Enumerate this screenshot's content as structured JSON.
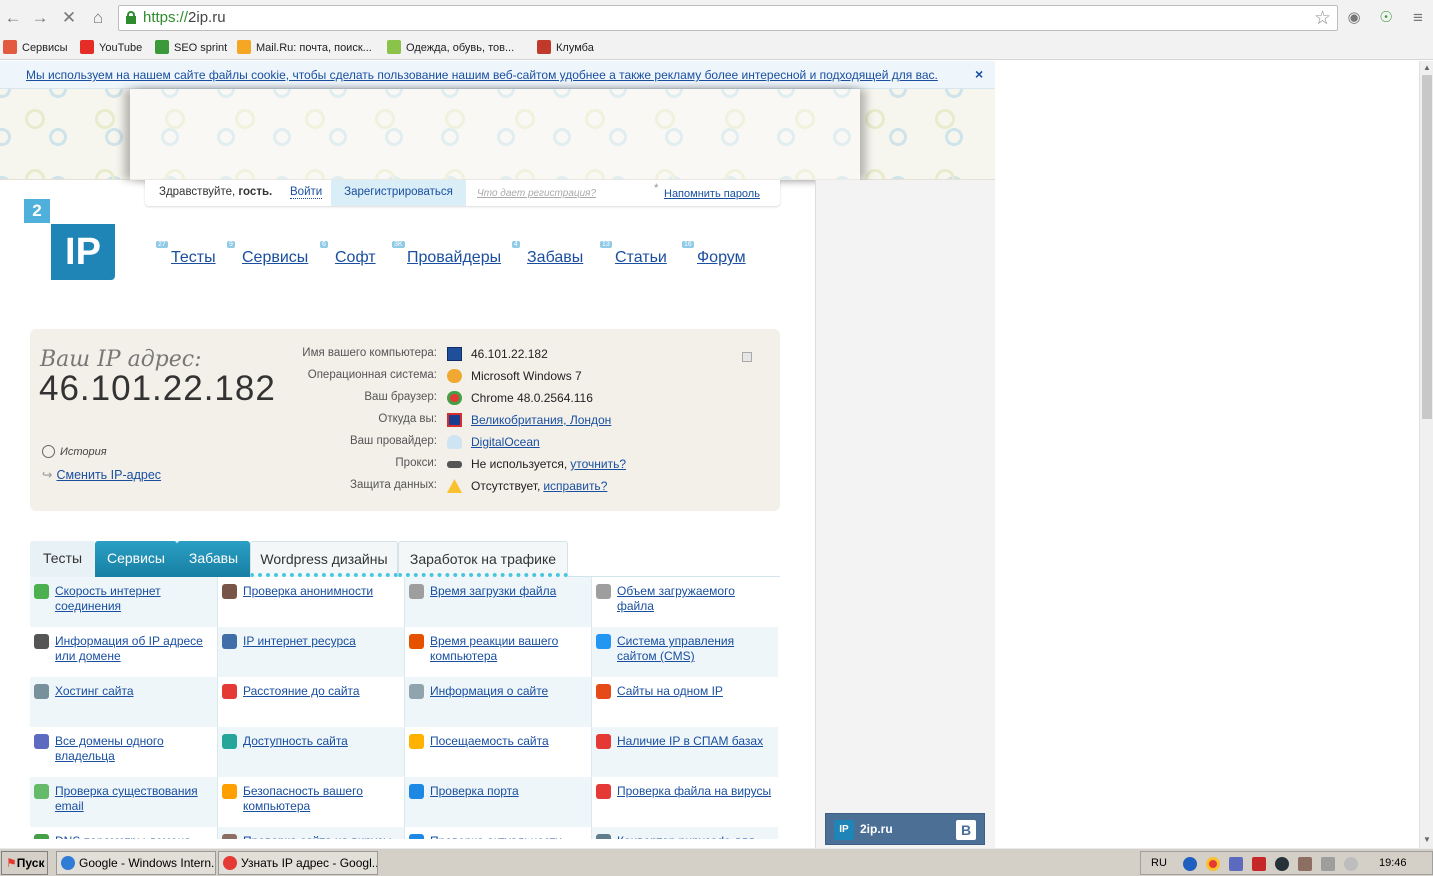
{
  "browser": {
    "url_scheme": "https://",
    "url_host": "2ip.ru",
    "bookmarks": [
      {
        "label": "Сервисы",
        "icon": "apps-grid-icon",
        "color": "#e25b3f"
      },
      {
        "label": "YouTube",
        "icon": "youtube-icon",
        "color": "#e52d27"
      },
      {
        "label": "SEO sprint",
        "icon": "seosprint-icon",
        "color": "#3a9a3a"
      },
      {
        "label": "Mail.Ru: почта, поиск...",
        "icon": "mailru-icon",
        "color": "#f5a623"
      },
      {
        "label": "Одежда, обувь, тов...",
        "icon": "shop-icon",
        "color": "#8bc34a"
      },
      {
        "label": "Клумба",
        "icon": "klumba-icon",
        "color": "#c0392b"
      }
    ]
  },
  "cookie": {
    "text": "Мы используем на нашем сайте файлы cookie, чтобы сделать пользование нашим веб-сайтом удобнее а также рекламу более интересной и подходящей для вас.",
    "close": "×"
  },
  "login": {
    "greeting": "Здравствуйте,",
    "guest": "гость.",
    "login": "Войти",
    "register": "Зарегистрироваться",
    "why": "Что дает регистрация?",
    "asterisk": "*",
    "remind": "Напомнить пароль"
  },
  "logo": {
    "two": "2",
    "ip": "IP"
  },
  "nav": [
    {
      "label": "Тесты",
      "count": "27"
    },
    {
      "label": "Сервисы",
      "count": "9"
    },
    {
      "label": "Софт",
      "count": "6"
    },
    {
      "label": "Провайдеры",
      "count": "3K"
    },
    {
      "label": "Забавы",
      "count": "4"
    },
    {
      "label": "Статьи",
      "count": "13"
    },
    {
      "label": "Форум",
      "count": "16"
    }
  ],
  "ipinfo": {
    "label": "Ваш IP адрес:",
    "value": "46.101.22.182",
    "history": "История",
    "change": "Сменить IP-адрес",
    "rows": [
      {
        "label": "Имя вашего компьютера:",
        "value": "46.101.22.182",
        "link": "",
        "icon": "computer-icon"
      },
      {
        "label": "Операционная система:",
        "value": "Microsoft Windows 7",
        "link": "",
        "icon": "windows-icon"
      },
      {
        "label": "Ваш браузер:",
        "value": "Chrome 48.0.2564.116",
        "link": "",
        "icon": "chrome-icon"
      },
      {
        "label": "Откуда вы:",
        "value": "",
        "link": "Великобритания, Лондон",
        "icon": "uk-flag-icon"
      },
      {
        "label": "Ваш провайдер:",
        "value": "",
        "link": "DigitalOcean",
        "icon": "cloud-icon"
      },
      {
        "label": "Прокси:",
        "value": "Не используется,",
        "link": "уточнить?",
        "icon": "glasses-icon"
      },
      {
        "label": "Защита данных:",
        "value": "Отсутствует,",
        "link": "исправить?",
        "icon": "warning-icon"
      }
    ]
  },
  "tabs": [
    {
      "label": "Тесты",
      "style": "light"
    },
    {
      "label": "Сервисы",
      "style": "active"
    },
    {
      "label": "Забавы",
      "style": "active"
    },
    {
      "label": "Wordpress дизайны",
      "style": "plain"
    },
    {
      "label": "Заработок на трафике",
      "style": "plain"
    }
  ],
  "tools": [
    {
      "label": "Скорость интернет соединения",
      "icon": "speed-icon",
      "color": "#4caf50"
    },
    {
      "label": "Проверка анонимности",
      "icon": "anonymity-icon",
      "color": "#795548"
    },
    {
      "label": "Время загрузки файла",
      "icon": "clock-icon",
      "color": "#9e9e9e"
    },
    {
      "label": "Объем загружаемого файла",
      "icon": "file-size-icon",
      "color": "#9e9e9e"
    },
    {
      "label": "Информация об IP адресе или домене",
      "icon": "ip-info-icon",
      "color": "#555555"
    },
    {
      "label": "IP интернет ресурса",
      "icon": "ip-resource-icon",
      "color": "#3f6ea8"
    },
    {
      "label": "Время реакции вашего компьютера",
      "icon": "reaction-icon",
      "color": "#e65100"
    },
    {
      "label": "Система управления сайтом (CMS)",
      "icon": "cms-icon",
      "color": "#2196f3"
    },
    {
      "label": "Хостинг сайта",
      "icon": "hosting-icon",
      "color": "#78909c"
    },
    {
      "label": "Расстояние до сайта",
      "icon": "pin-icon",
      "color": "#e53935"
    },
    {
      "label": "Информация о сайте",
      "icon": "document-icon",
      "color": "#90a4ae"
    },
    {
      "label": "Сайты на одном IP",
      "icon": "network-icon",
      "color": "#e64a19"
    },
    {
      "label": "Все домены одного владельца",
      "icon": "owner-icon",
      "color": "#5c6bc0"
    },
    {
      "label": "Доступность сайта",
      "icon": "availability-icon",
      "color": "#26a69a"
    },
    {
      "label": "Посещаемость сайта",
      "icon": "star-icon",
      "color": "#ffb300"
    },
    {
      "label": "Наличие IP в СПАМ базах",
      "icon": "spam-icon",
      "color": "#e53935"
    },
    {
      "label": "Проверка существования email",
      "icon": "email-icon",
      "color": "#66bb6a"
    },
    {
      "label": "Безопасность вашего компьютера",
      "icon": "lock-icon",
      "color": "#ffa000"
    },
    {
      "label": "Проверка порта",
      "icon": "port-icon",
      "color": "#1e88e5"
    },
    {
      "label": "Проверка файла на вирусы",
      "icon": "virus-file-icon",
      "color": "#e53935"
    },
    {
      "label": "DNS параметры домена",
      "icon": "dns-icon",
      "color": "#43a047"
    },
    {
      "label": "Проверка сайта на вирусы",
      "icon": "virus-site-icon",
      "color": "#8d6e63"
    },
    {
      "label": "Проверка актуальности",
      "icon": "globe-icon",
      "color": "#1e88e5"
    },
    {
      "label": "Конвертер punycode для",
      "icon": "converter-icon",
      "color": "#607d8b"
    }
  ],
  "vk_widget": {
    "ip": "IP",
    "name": "2ip.ru",
    "b": "B"
  },
  "taskbar": {
    "start": "Пуск",
    "tasks": [
      {
        "label": "Google - Windows Intern...",
        "color": "#2f7bd6"
      },
      {
        "label": "Узнать IP адрес - Googl...",
        "color": "#e53935"
      }
    ],
    "lang": "RU",
    "time": "19:46"
  }
}
